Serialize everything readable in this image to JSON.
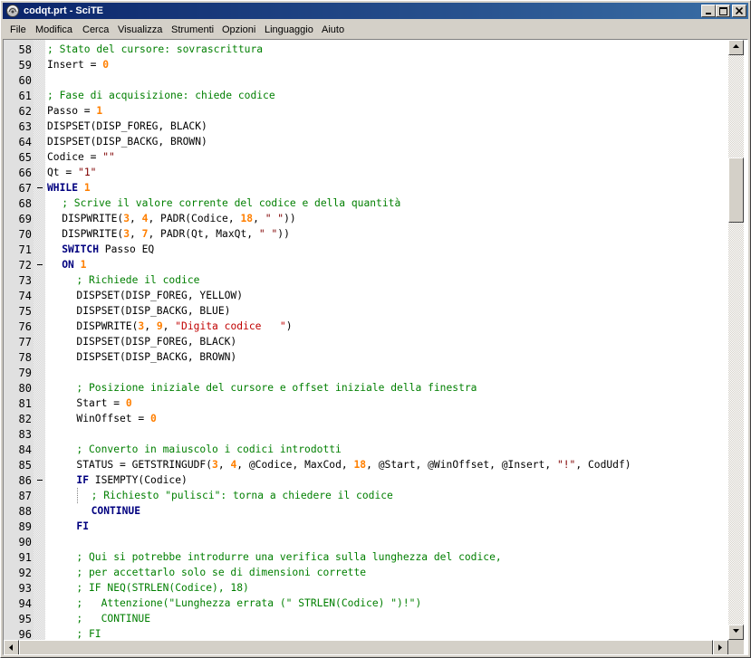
{
  "window": {
    "title": "codqt.prt - SciTE"
  },
  "menu": [
    "File",
    "Modifica",
    "Cerca",
    "Visualizza",
    "Strumenti",
    "Opzioni",
    "Linguaggio",
    "Aiuto"
  ],
  "colors": {
    "keyword": "#00007f",
    "comment": "#007f00",
    "number": "#ff7f00",
    "string": "#7f0000",
    "titlebar": "#0a246a"
  },
  "lines": [
    {
      "n": "58",
      "fold": "",
      "indent": 0,
      "tokens": [
        [
          "c",
          "; Stato del cursore: sovrascrittura"
        ]
      ]
    },
    {
      "n": "59",
      "fold": "",
      "indent": 0,
      "tokens": [
        [
          "t",
          "Insert = "
        ],
        [
          "n",
          "0"
        ]
      ]
    },
    {
      "n": "60",
      "fold": "",
      "indent": 0,
      "tokens": []
    },
    {
      "n": "61",
      "fold": "",
      "indent": 0,
      "tokens": [
        [
          "c",
          "; Fase di acquisizione: chiede codice"
        ]
      ]
    },
    {
      "n": "62",
      "fold": "",
      "indent": 0,
      "tokens": [
        [
          "t",
          "Passo = "
        ],
        [
          "n",
          "1"
        ]
      ]
    },
    {
      "n": "63",
      "fold": "",
      "indent": 0,
      "tokens": [
        [
          "t",
          "DISPSET(DISP_FOREG, BLACK)"
        ]
      ]
    },
    {
      "n": "64",
      "fold": "",
      "indent": 0,
      "tokens": [
        [
          "t",
          "DISPSET(DISP_BACKG, BROWN)"
        ]
      ]
    },
    {
      "n": "65",
      "fold": "",
      "indent": 0,
      "tokens": [
        [
          "t",
          "Codice = "
        ],
        [
          "s",
          "\"\""
        ]
      ]
    },
    {
      "n": "66",
      "fold": "",
      "indent": 0,
      "tokens": [
        [
          "t",
          "Qt = "
        ],
        [
          "s",
          "\"1\""
        ]
      ]
    },
    {
      "n": "67",
      "fold": "minus",
      "indent": 0,
      "tokens": [
        [
          "k",
          "WHILE"
        ],
        [
          "t",
          " "
        ],
        [
          "n",
          "1"
        ]
      ]
    },
    {
      "n": "68",
      "fold": "",
      "indent": 1,
      "tokens": [
        [
          "c",
          "; Scrive il valore corrente del codice e della quantità"
        ]
      ]
    },
    {
      "n": "69",
      "fold": "",
      "indent": 1,
      "tokens": [
        [
          "t",
          "DISPWRITE("
        ],
        [
          "n",
          "3"
        ],
        [
          "t",
          ", "
        ],
        [
          "n",
          "4"
        ],
        [
          "t",
          ", PADR(Codice, "
        ],
        [
          "n",
          "18"
        ],
        [
          "t",
          ", "
        ],
        [
          "s",
          "\" \""
        ],
        [
          "t",
          "))"
        ]
      ]
    },
    {
      "n": "70",
      "fold": "",
      "indent": 1,
      "tokens": [
        [
          "t",
          "DISPWRITE("
        ],
        [
          "n",
          "3"
        ],
        [
          "t",
          ", "
        ],
        [
          "n",
          "7"
        ],
        [
          "t",
          ", PADR(Qt, MaxQt, "
        ],
        [
          "s",
          "\" \""
        ],
        [
          "t",
          "))"
        ]
      ]
    },
    {
      "n": "71",
      "fold": "",
      "indent": 1,
      "tokens": [
        [
          "k",
          "SWITCH"
        ],
        [
          "t",
          " Passo EQ"
        ]
      ]
    },
    {
      "n": "72",
      "fold": "minus",
      "indent": 1,
      "tokens": [
        [
          "k",
          "ON"
        ],
        [
          "t",
          " "
        ],
        [
          "n",
          "1"
        ]
      ]
    },
    {
      "n": "73",
      "fold": "",
      "indent": 2,
      "tokens": [
        [
          "c",
          "; Richiede il codice"
        ]
      ]
    },
    {
      "n": "74",
      "fold": "",
      "indent": 2,
      "tokens": [
        [
          "t",
          "DISPSET(DISP_FOREG, YELLOW)"
        ]
      ]
    },
    {
      "n": "75",
      "fold": "",
      "indent": 2,
      "tokens": [
        [
          "t",
          "DISPSET(DISP_BACKG, BLUE)"
        ]
      ]
    },
    {
      "n": "76",
      "fold": "",
      "indent": 2,
      "tokens": [
        [
          "t",
          "DISPWRITE("
        ],
        [
          "n",
          "3"
        ],
        [
          "t",
          ", "
        ],
        [
          "n",
          "9"
        ],
        [
          "t",
          ", "
        ],
        [
          "r",
          "\"Digita codice   \""
        ],
        [
          "t",
          ")"
        ]
      ]
    },
    {
      "n": "77",
      "fold": "",
      "indent": 2,
      "tokens": [
        [
          "t",
          "DISPSET(DISP_FOREG, BLACK)"
        ]
      ]
    },
    {
      "n": "78",
      "fold": "",
      "indent": 2,
      "tokens": [
        [
          "t",
          "DISPSET(DISP_BACKG, BROWN)"
        ]
      ]
    },
    {
      "n": "79",
      "fold": "",
      "indent": 0,
      "tokens": []
    },
    {
      "n": "80",
      "fold": "",
      "indent": 2,
      "tokens": [
        [
          "c",
          "; Posizione iniziale del cursore e offset iniziale della finestra"
        ]
      ]
    },
    {
      "n": "81",
      "fold": "",
      "indent": 2,
      "tokens": [
        [
          "t",
          "Start = "
        ],
        [
          "n",
          "0"
        ]
      ]
    },
    {
      "n": "82",
      "fold": "",
      "indent": 2,
      "tokens": [
        [
          "t",
          "WinOffset = "
        ],
        [
          "n",
          "0"
        ]
      ]
    },
    {
      "n": "83",
      "fold": "",
      "indent": 0,
      "tokens": []
    },
    {
      "n": "84",
      "fold": "",
      "indent": 2,
      "tokens": [
        [
          "c",
          "; Converto in maiuscolo i codici introdotti"
        ]
      ]
    },
    {
      "n": "85",
      "fold": "",
      "indent": 2,
      "tokens": [
        [
          "t",
          "STATUS = GETSTRINGUDF("
        ],
        [
          "n",
          "3"
        ],
        [
          "t",
          ", "
        ],
        [
          "n",
          "4"
        ],
        [
          "t",
          ", @Codice, MaxCod, "
        ],
        [
          "n",
          "18"
        ],
        [
          "t",
          ", @Start, @WinOffset, @Insert, "
        ],
        [
          "s",
          "\"!\""
        ],
        [
          "t",
          ", CodUdf)"
        ]
      ]
    },
    {
      "n": "86",
      "fold": "minus",
      "indent": 2,
      "tokens": [
        [
          "k",
          "IF"
        ],
        [
          "t",
          " ISEMPTY(Codice)"
        ]
      ]
    },
    {
      "n": "87",
      "fold": "",
      "indent": 3,
      "guide": true,
      "tokens": [
        [
          "c",
          "; Richiesto \"pulisci\": torna a chiedere il codice"
        ]
      ]
    },
    {
      "n": "88",
      "fold": "",
      "indent": 3,
      "tokens": [
        [
          "k",
          "CONTINUE"
        ]
      ]
    },
    {
      "n": "89",
      "fold": "",
      "indent": 2,
      "tokens": [
        [
          "k",
          "FI"
        ]
      ]
    },
    {
      "n": "90",
      "fold": "",
      "indent": 0,
      "tokens": []
    },
    {
      "n": "91",
      "fold": "",
      "indent": 2,
      "tokens": [
        [
          "c",
          "; Qui si potrebbe introdurre una verifica sulla lunghezza del codice,"
        ]
      ]
    },
    {
      "n": "92",
      "fold": "",
      "indent": 2,
      "tokens": [
        [
          "c",
          "; per accettarlo solo se di dimensioni corrette"
        ]
      ]
    },
    {
      "n": "93",
      "fold": "",
      "indent": 2,
      "tokens": [
        [
          "c",
          "; IF NEQ(STRLEN(Codice), 18)"
        ]
      ]
    },
    {
      "n": "94",
      "fold": "",
      "indent": 2,
      "tokens": [
        [
          "c",
          ";   Attenzione(\"Lunghezza errata (\" STRLEN(Codice) \")!\")"
        ]
      ]
    },
    {
      "n": "95",
      "fold": "",
      "indent": 2,
      "tokens": [
        [
          "c",
          ";   CONTINUE"
        ]
      ]
    },
    {
      "n": "96",
      "fold": "",
      "indent": 2,
      "tokens": [
        [
          "c",
          "; FI"
        ]
      ]
    }
  ]
}
